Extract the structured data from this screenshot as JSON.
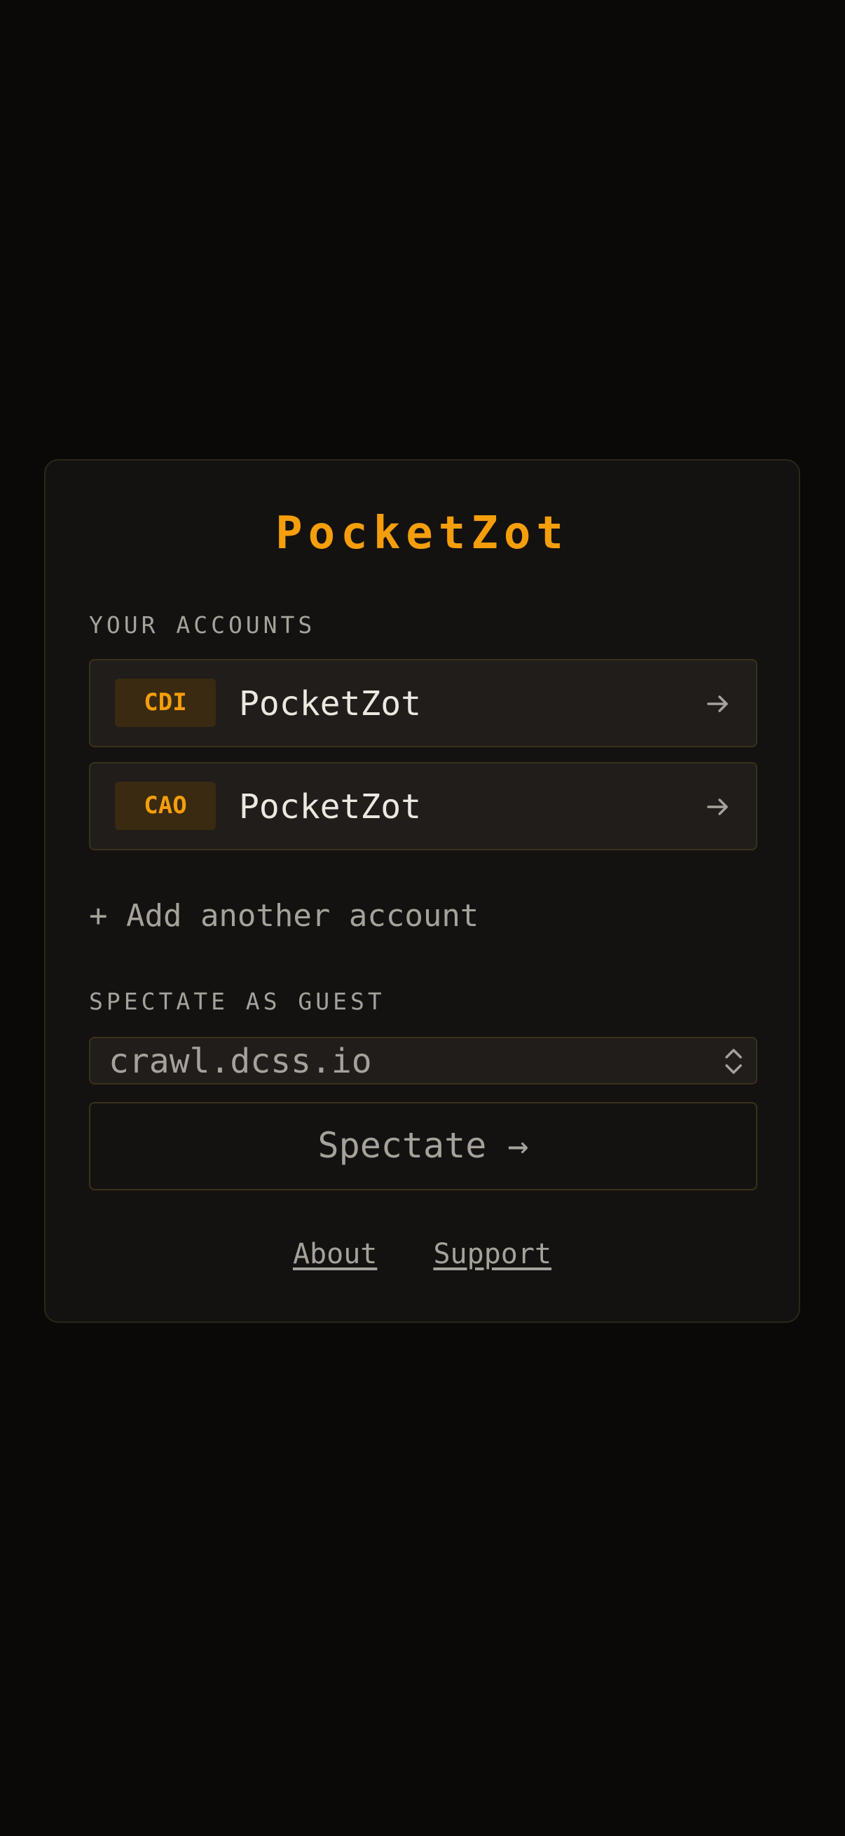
{
  "app": {
    "title": "PocketZot",
    "accent_color": "#f59e0b"
  },
  "accounts": {
    "label": "YOUR ACCOUNTS",
    "items": [
      {
        "server": "CDI",
        "name": "PocketZot",
        "icon": "arrow-right-icon"
      },
      {
        "server": "CAO",
        "name": "PocketZot",
        "icon": "arrow-right-icon"
      }
    ],
    "add_label": "+ Add another account"
  },
  "guest": {
    "label": "SPECTATE AS GUEST",
    "server_selected": "crawl.dcss.io",
    "select_icon": "chevron-up-down-icon",
    "spectate_label": "Spectate →"
  },
  "footer": {
    "about": "About",
    "support": "Support"
  }
}
